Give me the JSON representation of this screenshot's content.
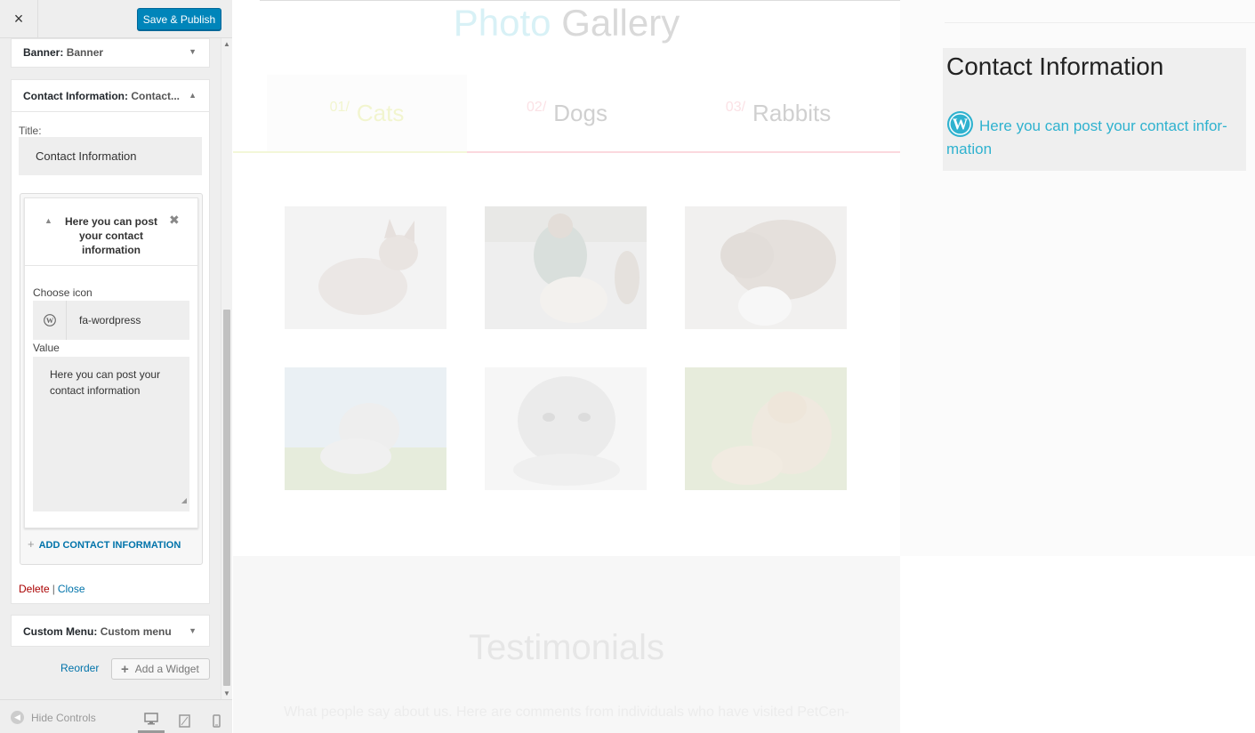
{
  "header": {
    "close_label": "×",
    "publish_button": "Save & Publish"
  },
  "widgets": {
    "banner": {
      "name": "Banner",
      "sub": "Banner"
    },
    "contact": {
      "name": "Contact Information",
      "sub": "Contact...",
      "title_label": "Title:",
      "title_value": "Contact Information",
      "item": {
        "heading": "Here you can post your contact information",
        "icon_label": "Choose icon",
        "icon_value": "fa-wordpress",
        "value_label": "Value",
        "value_text": "Here you can post your contact information"
      },
      "add_button": "ADD CONTACT INFORMATION",
      "delete_link": "Delete",
      "separator": "|",
      "close_link": "Close"
    },
    "custom_menu": {
      "name": "Custom Menu",
      "sub": "Custom menu"
    }
  },
  "reorder_link": "Reorder",
  "add_widget_button": "Add a Widget",
  "footer": {
    "hide_controls": "Hide Controls"
  },
  "preview": {
    "gallery_title_accent": "Photo",
    "gallery_title_rest": "Gallery",
    "tabs": [
      {
        "num": "01/",
        "label": "Cats"
      },
      {
        "num": "02/",
        "label": "Dogs"
      },
      {
        "num": "03/",
        "label": "Rabbits"
      }
    ],
    "contact_widget": {
      "heading": "Contact Information",
      "text": "Here you can post your contact infor-mation"
    },
    "testimonials_title": "Testimonials",
    "testimonials_sub": "What people say about us. Here are comments from individuals who have visited PetCen-"
  },
  "colors": {
    "primary": "#0085ba",
    "link": "#0073aa",
    "danger": "#aa0000",
    "accent": "#2fb2cf"
  }
}
